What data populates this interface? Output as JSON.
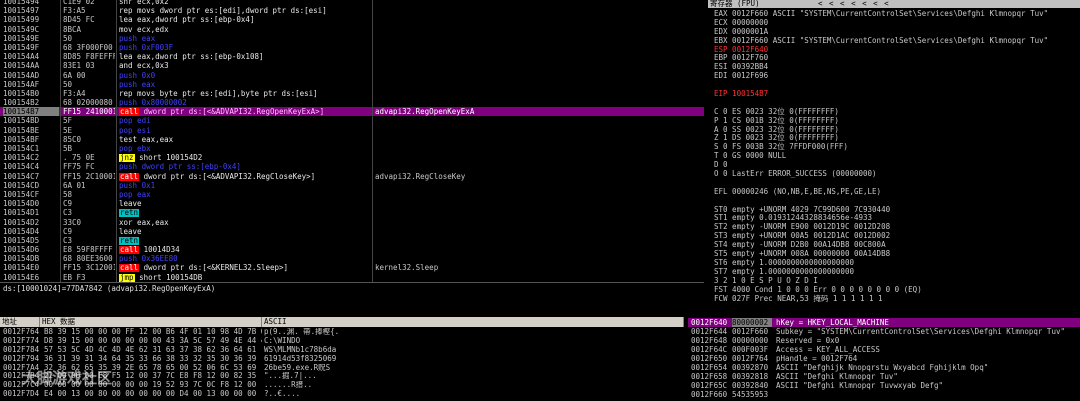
{
  "disasm": {
    "rows": [
      {
        "addr": "10015494",
        "hex": "C1E9 02",
        "asm": "shr ecx,0x2",
        "c": "m-white",
        "tag": ""
      },
      {
        "addr": "10015497",
        "hex": "F3:A5",
        "asm": "rep movs dword ptr es:[edi],dword ptr ds:[esi]",
        "c": "m-white",
        "tag": ""
      },
      {
        "addr": "10015499",
        "hex": "8D45 FC",
        "asm": "lea eax,dword ptr ss:[ebp-0x4]",
        "c": "m-white",
        "tag": ""
      },
      {
        "addr": "1001549C",
        "hex": "8BCA",
        "asm": "mov ecx,edx",
        "c": "m-white",
        "tag": ""
      },
      {
        "addr": "1001549E",
        "hex": "50",
        "asm": "push eax",
        "c": "m-blue",
        "tag": ""
      },
      {
        "addr": "1001549F",
        "hex": "68 3F000F00",
        "asm": "push 0xF003F",
        "c": "m-blue",
        "tag": ""
      },
      {
        "addr": "100154A4",
        "hex": "8D85 F8FEFFFF",
        "asm": "lea eax,dword ptr ss:[ebp-0x108]",
        "c": "m-white",
        "tag": ""
      },
      {
        "addr": "100154AA",
        "hex": "83E1 03",
        "asm": "and ecx,0x3",
        "c": "m-white",
        "tag": ""
      },
      {
        "addr": "100154AD",
        "hex": "6A 00",
        "asm": "push 0x0",
        "c": "m-blue",
        "tag": ""
      },
      {
        "addr": "100154AF",
        "hex": "50",
        "asm": "push eax",
        "c": "m-blue",
        "tag": ""
      },
      {
        "addr": "100154B0",
        "hex": "F3:A4",
        "asm": "rep movs byte ptr es:[edi],byte ptr ds:[esi]",
        "c": "m-white",
        "tag": ""
      },
      {
        "addr": "100154B2",
        "hex": "68 02000080",
        "asm": "push 0x80000002",
        "c": "m-blue",
        "tag": ""
      },
      {
        "addr": "100154B7",
        "hex": "FF15 24100010",
        "asm": "dword ptr ds:[<&ADVAPI32.RegOpenKeyExA>]",
        "c": "m-white",
        "tag": "call",
        "sel": true,
        "comment": "advapi32.RegOpenKeyExA"
      },
      {
        "addr": "100154BD",
        "hex": "5F",
        "asm": "pop edi",
        "c": "m-blue",
        "tag": ""
      },
      {
        "addr": "100154BE",
        "hex": "5E",
        "asm": "pop esi",
        "c": "m-blue",
        "tag": ""
      },
      {
        "addr": "100154BF",
        "hex": "85C0",
        "asm": "test eax,eax",
        "c": "m-white",
        "tag": ""
      },
      {
        "addr": "100154C1",
        "hex": "5B",
        "asm": "pop ebx",
        "c": "m-blue",
        "tag": ""
      },
      {
        "addr": "100154C2",
        "hex": ". 75 0E",
        "asm": "short 100154D2",
        "c": "m-white",
        "tag": "jnz"
      },
      {
        "addr": "100154C4",
        "hex": "FF75 FC",
        "asm": "push dword ptr ss:[ebp-0x4]",
        "c": "m-blue",
        "tag": ""
      },
      {
        "addr": "100154C7",
        "hex": "FF15 2C100010",
        "asm": "dword ptr ds:[<&ADVAPI32.RegCloseKey>]",
        "c": "m-white",
        "tag": "call",
        "comment": "advapi32.RegCloseKey"
      },
      {
        "addr": "100154CD",
        "hex": "6A 01",
        "asm": "push 0x1",
        "c": "m-blue",
        "tag": ""
      },
      {
        "addr": "100154CF",
        "hex": "58",
        "asm": "pop eax",
        "c": "m-blue",
        "tag": ""
      },
      {
        "addr": "100154D0",
        "hex": "C9",
        "asm": "leave",
        "c": "m-white",
        "tag": ""
      },
      {
        "addr": "100154D1",
        "hex": "C3",
        "asm": "",
        "c": "m-white",
        "tag": "retn"
      },
      {
        "addr": "100154D2",
        "hex": "33C0",
        "asm": "xor eax,eax",
        "c": "m-white",
        "tag": ""
      },
      {
        "addr": "100154D4",
        "hex": "C9",
        "asm": "leave",
        "c": "m-white",
        "tag": ""
      },
      {
        "addr": "100154D5",
        "hex": "C3",
        "asm": "",
        "c": "m-white",
        "tag": "retn"
      },
      {
        "addr": "100154D6",
        "hex": "E8 59F8FFFF",
        "asm": "10014D34",
        "c": "m-white",
        "tag": "call"
      },
      {
        "addr": "100154DB",
        "hex": "68 80EE3600",
        "asm": "push 0x36EE80",
        "c": "m-blue",
        "tag": ""
      },
      {
        "addr": "100154E0",
        "hex": "FF15 3C120010",
        "asm": "dword ptr ds:[<&KERNEL32.Sleep>]",
        "c": "m-white",
        "tag": "call",
        "comment": "kernel32.Sleep"
      },
      {
        "addr": "100154E6",
        "hex": "EB F3",
        "asm": "short 100154DB",
        "c": "m-white",
        "tag": "jmp"
      }
    ],
    "info": "ds:[10001024]=77DA7842 (advapi32.RegOpenKeyExA)"
  },
  "registers": {
    "title": "寄存器 (FPU)",
    "nav": "<   <   <   <   <   <   <",
    "lines": [
      {
        "t": "EAX 0012F660 ASCII \"SYSTEM\\CurrentControlSet\\Services\\Defghi Klmnopqr Tuv\"",
        "hl": "0012F660"
      },
      {
        "t": "ECX 00000000"
      },
      {
        "t": "EDX 0000001A"
      },
      {
        "t": "EBX 0012F660 ASCII \"SYSTEM\\CurrentControlSet\\Services\\Defghi Klmnopqr Tuv\""
      },
      {
        "t": "ESP 0012F640",
        "red": true
      },
      {
        "t": "EBP 0012F760"
      },
      {
        "t": "ESI 00392BB4"
      },
      {
        "t": "EDI 0012F696"
      },
      {
        "t": ""
      },
      {
        "t": "EIP 100154B7",
        "red": true
      },
      {
        "t": ""
      },
      {
        "t": "C 0  ES 0023 32位 0(FFFFFFFF)"
      },
      {
        "t": "P 1  CS 001B 32位 0(FFFFFFFF)"
      },
      {
        "t": "A 0  SS 0023 32位 0(FFFFFFFF)"
      },
      {
        "t": "Z 1  DS 0023 32位 0(FFFFFFFF)"
      },
      {
        "t": "S 0  FS 003B 32位 7FFDF000(FFF)"
      },
      {
        "t": "T 0  GS 0000 NULL"
      },
      {
        "t": "D 0"
      },
      {
        "t": "O 0  LastErr ERROR_SUCCESS (00000000)"
      },
      {
        "t": ""
      },
      {
        "t": "EFL 00000246 (NO,NB,E,BE,NS,PE,GE,LE)"
      },
      {
        "t": ""
      },
      {
        "t": "ST0 empty +UNORM 4029 7C99D600 7C930440"
      },
      {
        "t": "ST1 empty 0.01931244328834656e-4933"
      },
      {
        "t": "ST2 empty -UNORM E900 0012D19C 0012D208"
      },
      {
        "t": "ST3 empty +UNORM 00A5 0012D1AC 0012D002"
      },
      {
        "t": "ST4 empty -UNORM D2B0 00A14DB8 00C800A"
      },
      {
        "t": "ST5 empty +UNORM 008A 00000000 00A14DB8"
      },
      {
        "t": "ST6 empty 1.0000000000000000000"
      },
      {
        "t": "ST7 empty 1.0000000000000000000"
      },
      {
        "t": "              3 2 1 0      E S P U O Z D I"
      },
      {
        "t": "FST 4000  Cond 1 0 0 0  Err 0 0 0 0 0 0 0 0  (EQ)"
      },
      {
        "t": "FCW 027F  Prec NEAR,53  掩码    1 1 1 1 1 1"
      }
    ]
  },
  "dump": {
    "headers": [
      "地址",
      "HEX 数据",
      "ASCII"
    ],
    "rows": [
      {
        "a": "0012F764",
        "h": "B8 39 15 00 00 00 FF 12 00 B6 4F 01 10 98 4D 7B 00",
        "s": "p(9..渊.  帶.捧樫{."
      },
      {
        "a": "0012F774",
        "h": "D8 39 15 00 00 00 00 00 00 43 3A 5C 57 49 4E 44 4F",
        "s": "C:\\WINDO"
      },
      {
        "a": "0012F784",
        "h": "57 53 5C 4D 4C 4D 4E 62 31 63 37 38 62 36 64 61",
        "s": "WS\\MLMNb1c78b6da"
      },
      {
        "a": "0012F794",
        "h": "36 31 39 31 34 64 35 33 66 38 33 32 35 30 36 39",
        "s": "61914d53f8325069"
      },
      {
        "a": "0012F7A4",
        "h": "32 36 62 65 35 39 2E 65 78 65 00 52 06 6C 53 69",
        "s": "26be59.exe.R贶S"
      },
      {
        "a": "0012F7B4",
        "h": "22 00 00 00 E8 F5 12 00 37 7C E8 F8 12 00 82 35",
        "s": "\"...掘.7|..."
      },
      {
        "a": "0012F7C4",
        "h": "00 00 00 00 00 00 00 00 19 52 93 7C 0C F8 12 00",
        "s": "......R搢.."
      },
      {
        "a": "0012F7D4",
        "h": "E4 00 13 00 80 00 00 00 00 00 D4 00 13 00 00 00",
        "s": "?..€...."
      }
    ]
  },
  "stack": {
    "rows": [
      {
        "a": "0012F640",
        "v": "80000002",
        "c": "hKey = HKEY_LOCAL_MACHINE",
        "sel": true
      },
      {
        "a": "0012F644",
        "v": "0012F660",
        "c": "Subkey = \"SYSTEM\\CurrentControlSet\\Services\\Defghi Klmnopqr Tuv\""
      },
      {
        "a": "0012F648",
        "v": "00000000",
        "c": "Reserved = 0x0"
      },
      {
        "a": "0012F64C",
        "v": "000F003F",
        "c": "Access = KEY_ALL_ACCESS"
      },
      {
        "a": "0012F650",
        "v": "0012F764",
        "c": "pHandle = 0012F764"
      },
      {
        "a": "0012F654",
        "v": "00392870",
        "c": "ASCII \"Defghijk Nnopqrstu Wxyabcd Fghijklm Opq\""
      },
      {
        "a": "0012F658",
        "v": "00392818",
        "c": "ASCII \"Defghi Klmnopqr Tuv\""
      },
      {
        "a": "0012F65C",
        "v": "00392840",
        "c": "ASCII \"Defghi Klmnopqr Tuvwxyab Defg\""
      },
      {
        "a": "0012F660",
        "v": "54535953",
        "c": ""
      }
    ]
  },
  "watermark": "大脚游戏社区"
}
